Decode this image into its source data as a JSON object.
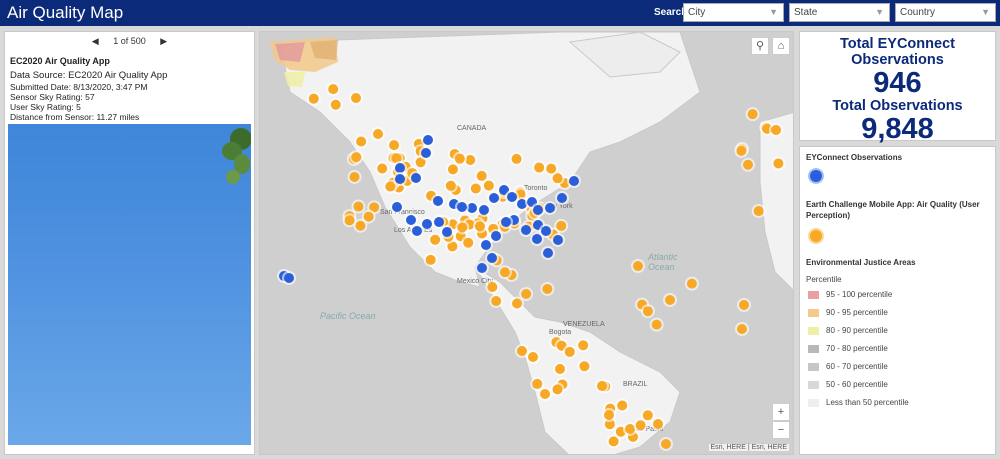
{
  "header": {
    "title": "Air Quality Map",
    "search_label": "Search",
    "filters": [
      {
        "placeholder": "City"
      },
      {
        "placeholder": "State"
      },
      {
        "placeholder": "Country"
      }
    ]
  },
  "popup": {
    "pager": "1 of 500",
    "title": "EC2020 Air Quality App",
    "data_source": "Data Source: EC2020 Air Quality App",
    "submitted": "Submitted Date: 8/13/2020, 3:47 PM",
    "sensor_sky": "Sensor Sky Rating: 57",
    "user_sky": "User Sky Rating: 5",
    "distance": "Distance from Sensor: 11.27 miles"
  },
  "map": {
    "attribution": "Esri, HERE | Esri, HERE",
    "labels": {
      "canada": "CANADA",
      "san_francisco": "San Francisco",
      "los_angeles": "Los Angeles",
      "toronto": "Toronto",
      "new_york": "New York",
      "mexico_city": "Mexico City",
      "venezuela": "VENEZUELA",
      "bogota": "Bogota",
      "brazil": "BRAZIL",
      "sao_paulo": "São Paulo",
      "pacific": "Pacific Ocean",
      "atlantic": "Atlantic Ocean"
    },
    "zoom_in": "+",
    "zoom_out": "−",
    "colors": {
      "orange": "#f7a825",
      "blue": "#2b5fd9"
    }
  },
  "stats": {
    "ey_title": "Total EYConnect Observations",
    "ey_value": "946",
    "total_title": "Total Observations",
    "total_value": "9,848"
  },
  "legend": {
    "ey_label": "EYConnect Observations",
    "earth_label": "Earth Challenge Mobile App: Air Quality (User Perception)",
    "ej_label": "Environmental Justice Areas",
    "percentile_label": "Percentile",
    "rows": [
      {
        "label": "95 - 100 percentile",
        "color": "#e8a0a0"
      },
      {
        "label": "90 - 95 percentile",
        "color": "#f2c98a"
      },
      {
        "label": "80 - 90 percentile",
        "color": "#eef0a8"
      },
      {
        "label": "70 - 80 percentile",
        "color": "#b8b8b8"
      },
      {
        "label": "60 - 70 percentile",
        "color": "#c6c6c6"
      },
      {
        "label": "50 - 60 percentile",
        "color": "#d8d8d8"
      },
      {
        "label": "Less than 50 percentile",
        "color": "#efefef"
      }
    ]
  }
}
